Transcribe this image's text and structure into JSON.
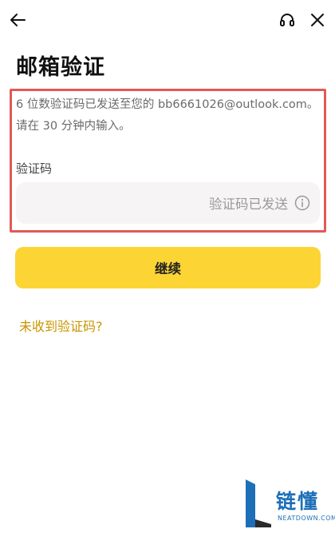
{
  "header": {
    "back_icon": "arrow-left-icon",
    "support_icon": "headset-icon",
    "close_icon": "close-icon"
  },
  "page": {
    "title": "邮箱验证"
  },
  "verification": {
    "description_line1": "6 位数验证码已发送至您的 bb6661026@outlook.com。",
    "description_line2": "请在 30 分钟内输入。",
    "field_label": "验证码",
    "input_status": "验证码已发送",
    "info_icon": "info-circle-icon"
  },
  "actions": {
    "continue_label": "继续",
    "resend_link": "未收到验证码?"
  },
  "watermark": {
    "text": "链懂",
    "subtext": "NEATDOWN.COM"
  },
  "colors": {
    "accent": "#fcd535",
    "link": "#c99400",
    "highlight_border": "#e05a57",
    "input_bg": "#f6f4f5",
    "watermark_blue": "#1d6fb8"
  }
}
